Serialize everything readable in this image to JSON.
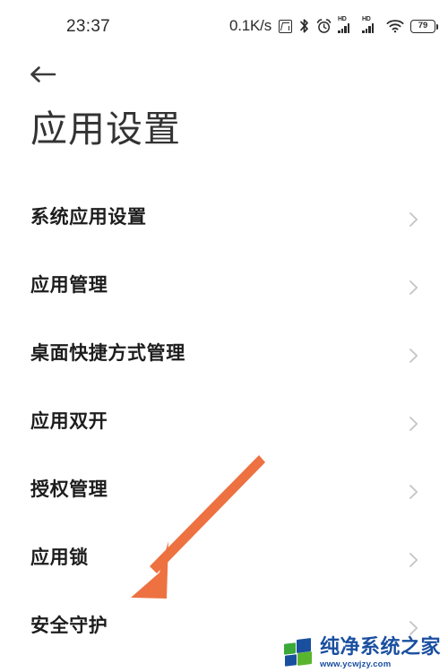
{
  "status_bar": {
    "time": "23:37",
    "network_speed": "0.1K/s",
    "battery_percent": "79",
    "icons": [
      {
        "name": "nfc-icon",
        "label": "NFC"
      },
      {
        "name": "bluetooth-icon",
        "label": "Bluetooth"
      },
      {
        "name": "alarm-clock-icon",
        "label": "Alarm"
      },
      {
        "name": "signal-sim1-icon",
        "label": "HD"
      },
      {
        "name": "signal-sim2-icon",
        "label": "HD"
      },
      {
        "name": "wifi-icon",
        "label": "Wi-Fi"
      },
      {
        "name": "battery-icon",
        "label": "79"
      }
    ]
  },
  "navigation": {
    "back_label": "返回"
  },
  "header": {
    "title": "应用设置"
  },
  "list": {
    "items": [
      {
        "label": "系统应用设置",
        "name": "sidebar-item-system-app-settings"
      },
      {
        "label": "应用管理",
        "name": "sidebar-item-app-management"
      },
      {
        "label": "桌面快捷方式管理",
        "name": "sidebar-item-home-shortcut-management"
      },
      {
        "label": "应用双开",
        "name": "sidebar-item-dual-apps"
      },
      {
        "label": "授权管理",
        "name": "sidebar-item-permission-management"
      },
      {
        "label": "应用锁",
        "name": "sidebar-item-app-lock"
      },
      {
        "label": "安全守护",
        "name": "sidebar-item-security-guard"
      }
    ]
  },
  "annotation": {
    "arrow_color": "#ED7141",
    "target_item": "安全守护"
  },
  "watermark": {
    "name": "纯净系统之家",
    "url": "www.ycwjzy.com",
    "brand_blue": "#1a4fa0",
    "brand_green": "#4aad35"
  },
  "colors": {
    "background": "#ffffff",
    "text_primary": "#1d1d1d",
    "title": "#333333",
    "chevron": "#c8c8c8"
  }
}
